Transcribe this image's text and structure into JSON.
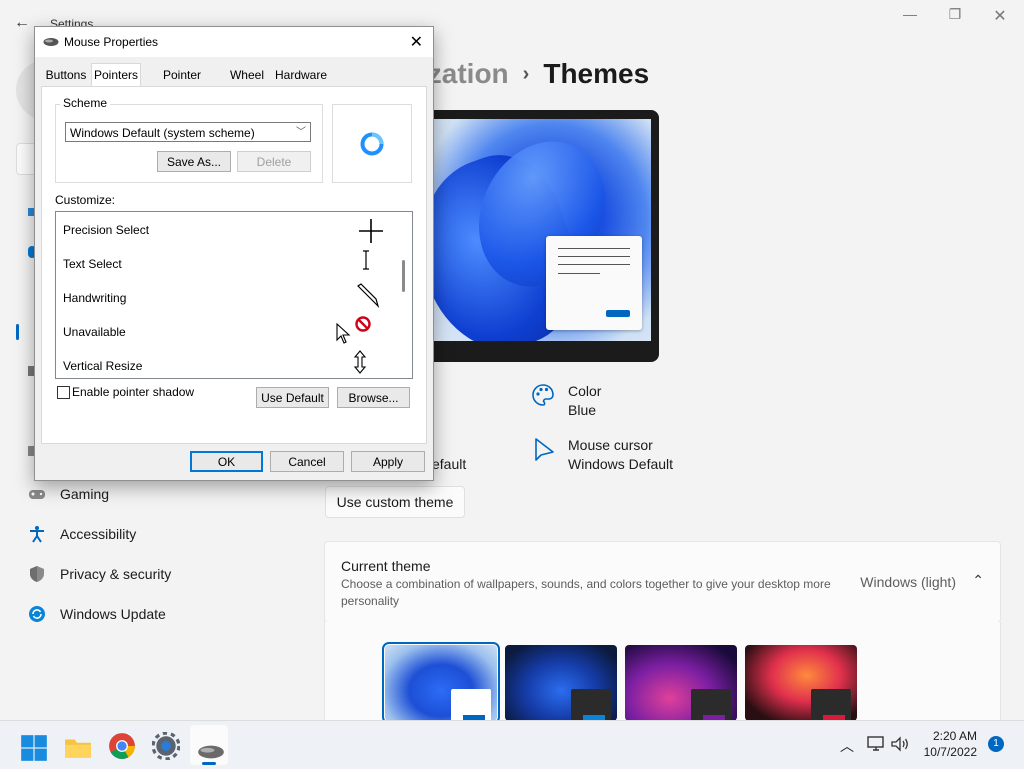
{
  "settings": {
    "title": "Settings",
    "breadcrumb_parent": "ization",
    "breadcrumb_sep": "›",
    "breadcrumb_current": "Themes",
    "props": {
      "color_label": "Color",
      "color_value": "Blue",
      "cursor_label": "Mouse cursor",
      "cursor_value": "Windows Default",
      "partial_default": "efault"
    },
    "custom_theme_button": "Use custom theme",
    "current_theme": {
      "title": "Current theme",
      "description": "Choose a combination of wallpapers, sounds, and colors together to give your desktop more personality",
      "value": "Windows (light)"
    },
    "nav": [
      {
        "label": "Gaming",
        "icon": "gamepad-icon"
      },
      {
        "label": "Accessibility",
        "icon": "accessibility-icon"
      },
      {
        "label": "Privacy & security",
        "icon": "shield-icon"
      },
      {
        "label": "Windows Update",
        "icon": "update-icon"
      }
    ],
    "accent_color": "#0067c0"
  },
  "dialog": {
    "title": "Mouse Properties",
    "tabs": [
      "Buttons",
      "Pointers",
      "Pointer Options",
      "Wheel",
      "Hardware"
    ],
    "active_tab": "Pointers",
    "scheme_label": "Scheme",
    "scheme_value": "Windows Default (system scheme)",
    "save_as": "Save As...",
    "delete": "Delete",
    "customize_label": "Customize:",
    "cursors": [
      {
        "label": "Precision Select",
        "icon": "crosshair-icon"
      },
      {
        "label": "Text Select",
        "icon": "ibeam-icon"
      },
      {
        "label": "Handwriting",
        "icon": "pen-icon"
      },
      {
        "label": "Unavailable",
        "icon": "unavailable-icon"
      },
      {
        "label": "Vertical Resize",
        "icon": "vertical-resize-icon"
      }
    ],
    "shadow_label": "Enable pointer shadow",
    "use_default": "Use Default",
    "browse": "Browse...",
    "ok": "OK",
    "cancel": "Cancel",
    "apply": "Apply"
  },
  "taskbar": {
    "time": "2:20 AM",
    "date": "10/7/2022",
    "notification_count": "1"
  }
}
